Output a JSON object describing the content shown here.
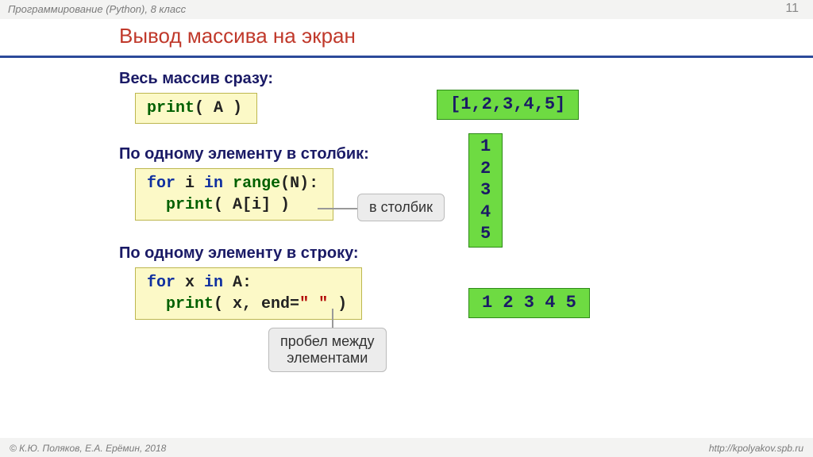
{
  "meta": {
    "course": "Программирование (Python), 8 класс",
    "page": "11",
    "copyright": "© К.Ю. Поляков, Е.А. Ерёмин, 2018",
    "url": "http://kpolyakov.spb.ru"
  },
  "title": "Вывод массива на экран",
  "sections": {
    "all": {
      "heading": "Весь массив сразу:",
      "code_plain": "print( A )",
      "output": "[1,2,3,4,5]"
    },
    "column": {
      "heading": "По одному элементу в столбик:",
      "code_plain": "for i in range(N):\n  print( A[i] )",
      "callout": "в столбик",
      "output": "1\n2\n3\n4\n5"
    },
    "row": {
      "heading": "По одному элементу в строку:",
      "code_plain": "for x in A:\n  print( x, end=\" \" )",
      "callout": "пробел между\nэлементами",
      "output": "1 2 3 4 5"
    }
  }
}
